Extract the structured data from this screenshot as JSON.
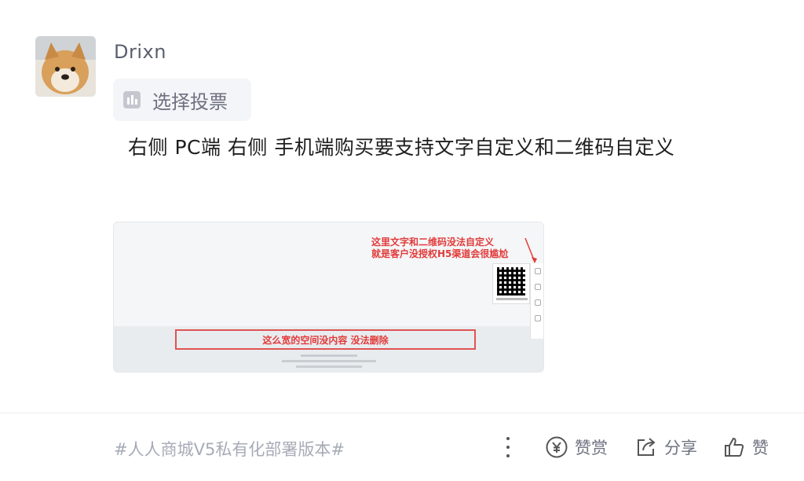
{
  "post": {
    "username": "Drixn",
    "vote_label": "选择投票",
    "text": "右侧 PC端 右侧 手机端购买要支持文字自定义和二维码自定义"
  },
  "attachment": {
    "note_line1": "这里文字和二维码没法自定义",
    "note_line2": "就是客户没授权H5渠道会很尴尬",
    "box_text": "这么宽的空间没内容 没法删除"
  },
  "footer": {
    "tag": "#人人商城V5私有化部署版本#",
    "reward_label": "赞赏",
    "share_label": "分享",
    "like_label": "赞"
  },
  "icons": {
    "vote": "bar-chart-icon",
    "more": "more-vertical-icon",
    "reward": "yen-coin-icon",
    "share": "share-arrow-icon",
    "like": "thumbs-up-icon"
  }
}
